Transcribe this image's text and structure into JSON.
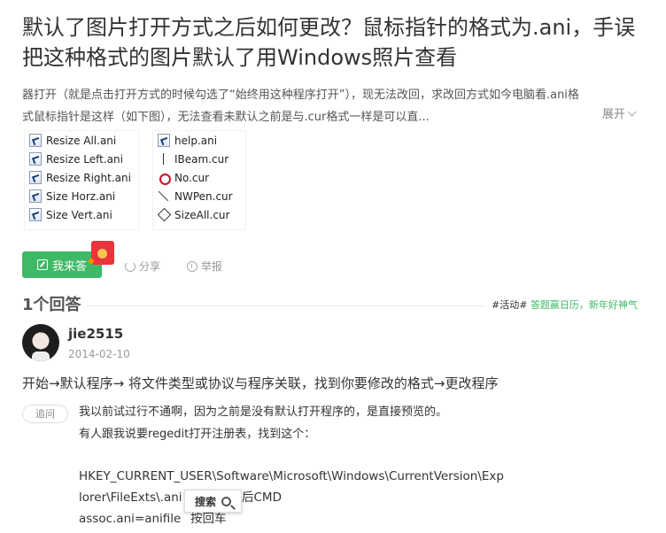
{
  "question": {
    "title": "默认了图片打开方式之后如何更改？鼠标指针的格式为.ani，手误把这种格式的图片默认了用Windows照片查看",
    "desc_line1": "器打开（就是点击打开方式的时候勾选了“始终用这种程序打开”），现无法改回，求改回方式如今电脑看.ani格",
    "desc_line2": "式鼠标指针是这样（如下图），无法查看未默认之前是与.cur格式一样是可以直...",
    "expand_label": "展开"
  },
  "images": {
    "left_files": [
      "Resize All.ani",
      "Resize Left.ani",
      "Resize Right.ani",
      "Size Horz.ani",
      "Size Vert.ani"
    ],
    "right_files": [
      "help.ani",
      "IBeam.cur",
      "No.cur",
      "NWPen.cur",
      "SizeAll.cur"
    ]
  },
  "actions": {
    "answer_label": "我来答",
    "share_label": "分享",
    "report_label": "举报"
  },
  "answers_section": {
    "count_label": "1个回答",
    "activity_tag": "#活动#",
    "activity_link": "答题赢日历，新年好神气"
  },
  "answer": {
    "username": "jie2515",
    "date": "2014-02-10",
    "text": "开始→默认程序→ 将文件类型或协议与程序关联，找到你要修改的格式→更改程序"
  },
  "followup": {
    "label": "追问",
    "lines": [
      "我以前试过行不通啊，因为之前是没有默认打开程序的，是直接预览的。",
      "有人跟我说要regedit打开注册表，找到这个：",
      "",
      "HKEY_CURRENT_USER\\Software\\Microsoft\\Windows\\CurrentVersion\\Exp",
      "lorer\\FileExts\\.ani",
      "后CMD",
      "assoc.ani=anifile",
      "按回车"
    ]
  },
  "search_popup": {
    "label": "搜索"
  }
}
